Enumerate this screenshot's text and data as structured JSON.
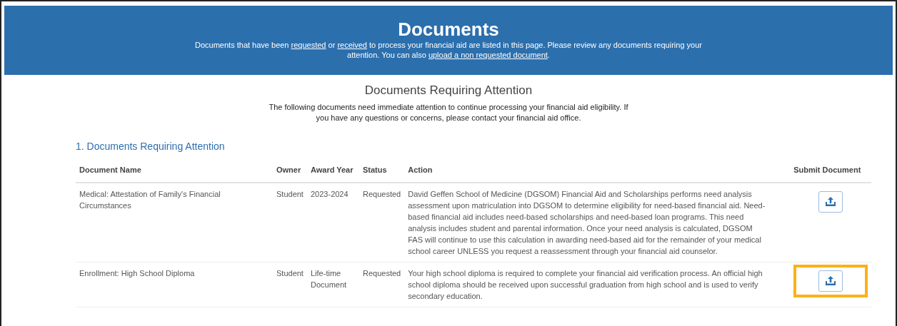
{
  "header": {
    "title": "Documents",
    "intro": [
      {
        "kind": "text",
        "text": "Documents that have been"
      },
      {
        "kind": "link",
        "text": "requested"
      },
      {
        "kind": "text",
        "text": "or"
      },
      {
        "kind": "link",
        "text": "received"
      },
      {
        "kind": "text",
        "text": "to process your financial aid are listed in this page. Please review any documents requiring your attention. You can also"
      },
      {
        "kind": "link",
        "text": "upload a non requested document"
      },
      {
        "kind": "text",
        "text": "."
      }
    ]
  },
  "section": {
    "title": "Documents Requiring Attention",
    "description": "The following documents need immediate attention to continue processing your financial aid eligibility. If you have any questions or concerns, please contact your financial aid office."
  },
  "group": {
    "title": "1. Documents Requiring Attention"
  },
  "table": {
    "columns": [
      "Document Name",
      "Owner",
      "Award Year",
      "Status",
      "Action",
      "Submit Document"
    ],
    "rows": [
      {
        "name": "Medical: Attestation of Family's Financial Circumstances",
        "owner": "Student",
        "award_year": "2023-2024",
        "status": "Requested",
        "action": "David Geffen School of Medicine (DGSOM) Financial Aid and Scholarships performs need analysis assessment upon matriculation into DGSOM to determine eligibility for need-based financial aid. Need-based financial aid includes need-based scholarships and need-based loan programs. This need analysis includes student and parental information. Once your need analysis is calculated, DGSOM FAS will continue to use this calculation in awarding need-based aid for the remainder of your medical school career UNLESS you request a reassessment through your financial aid counselor.",
        "highlighted": false
      },
      {
        "name": "Enrollment: High School Diploma",
        "owner": "Student",
        "award_year": "Life-time Document",
        "status": "Requested",
        "action": "Your high school diploma is required to complete your financial aid verification process. An official high school diploma should be received upon successful graduation from high school and is used to verify secondary education.",
        "highlighted": true
      }
    ]
  }
}
